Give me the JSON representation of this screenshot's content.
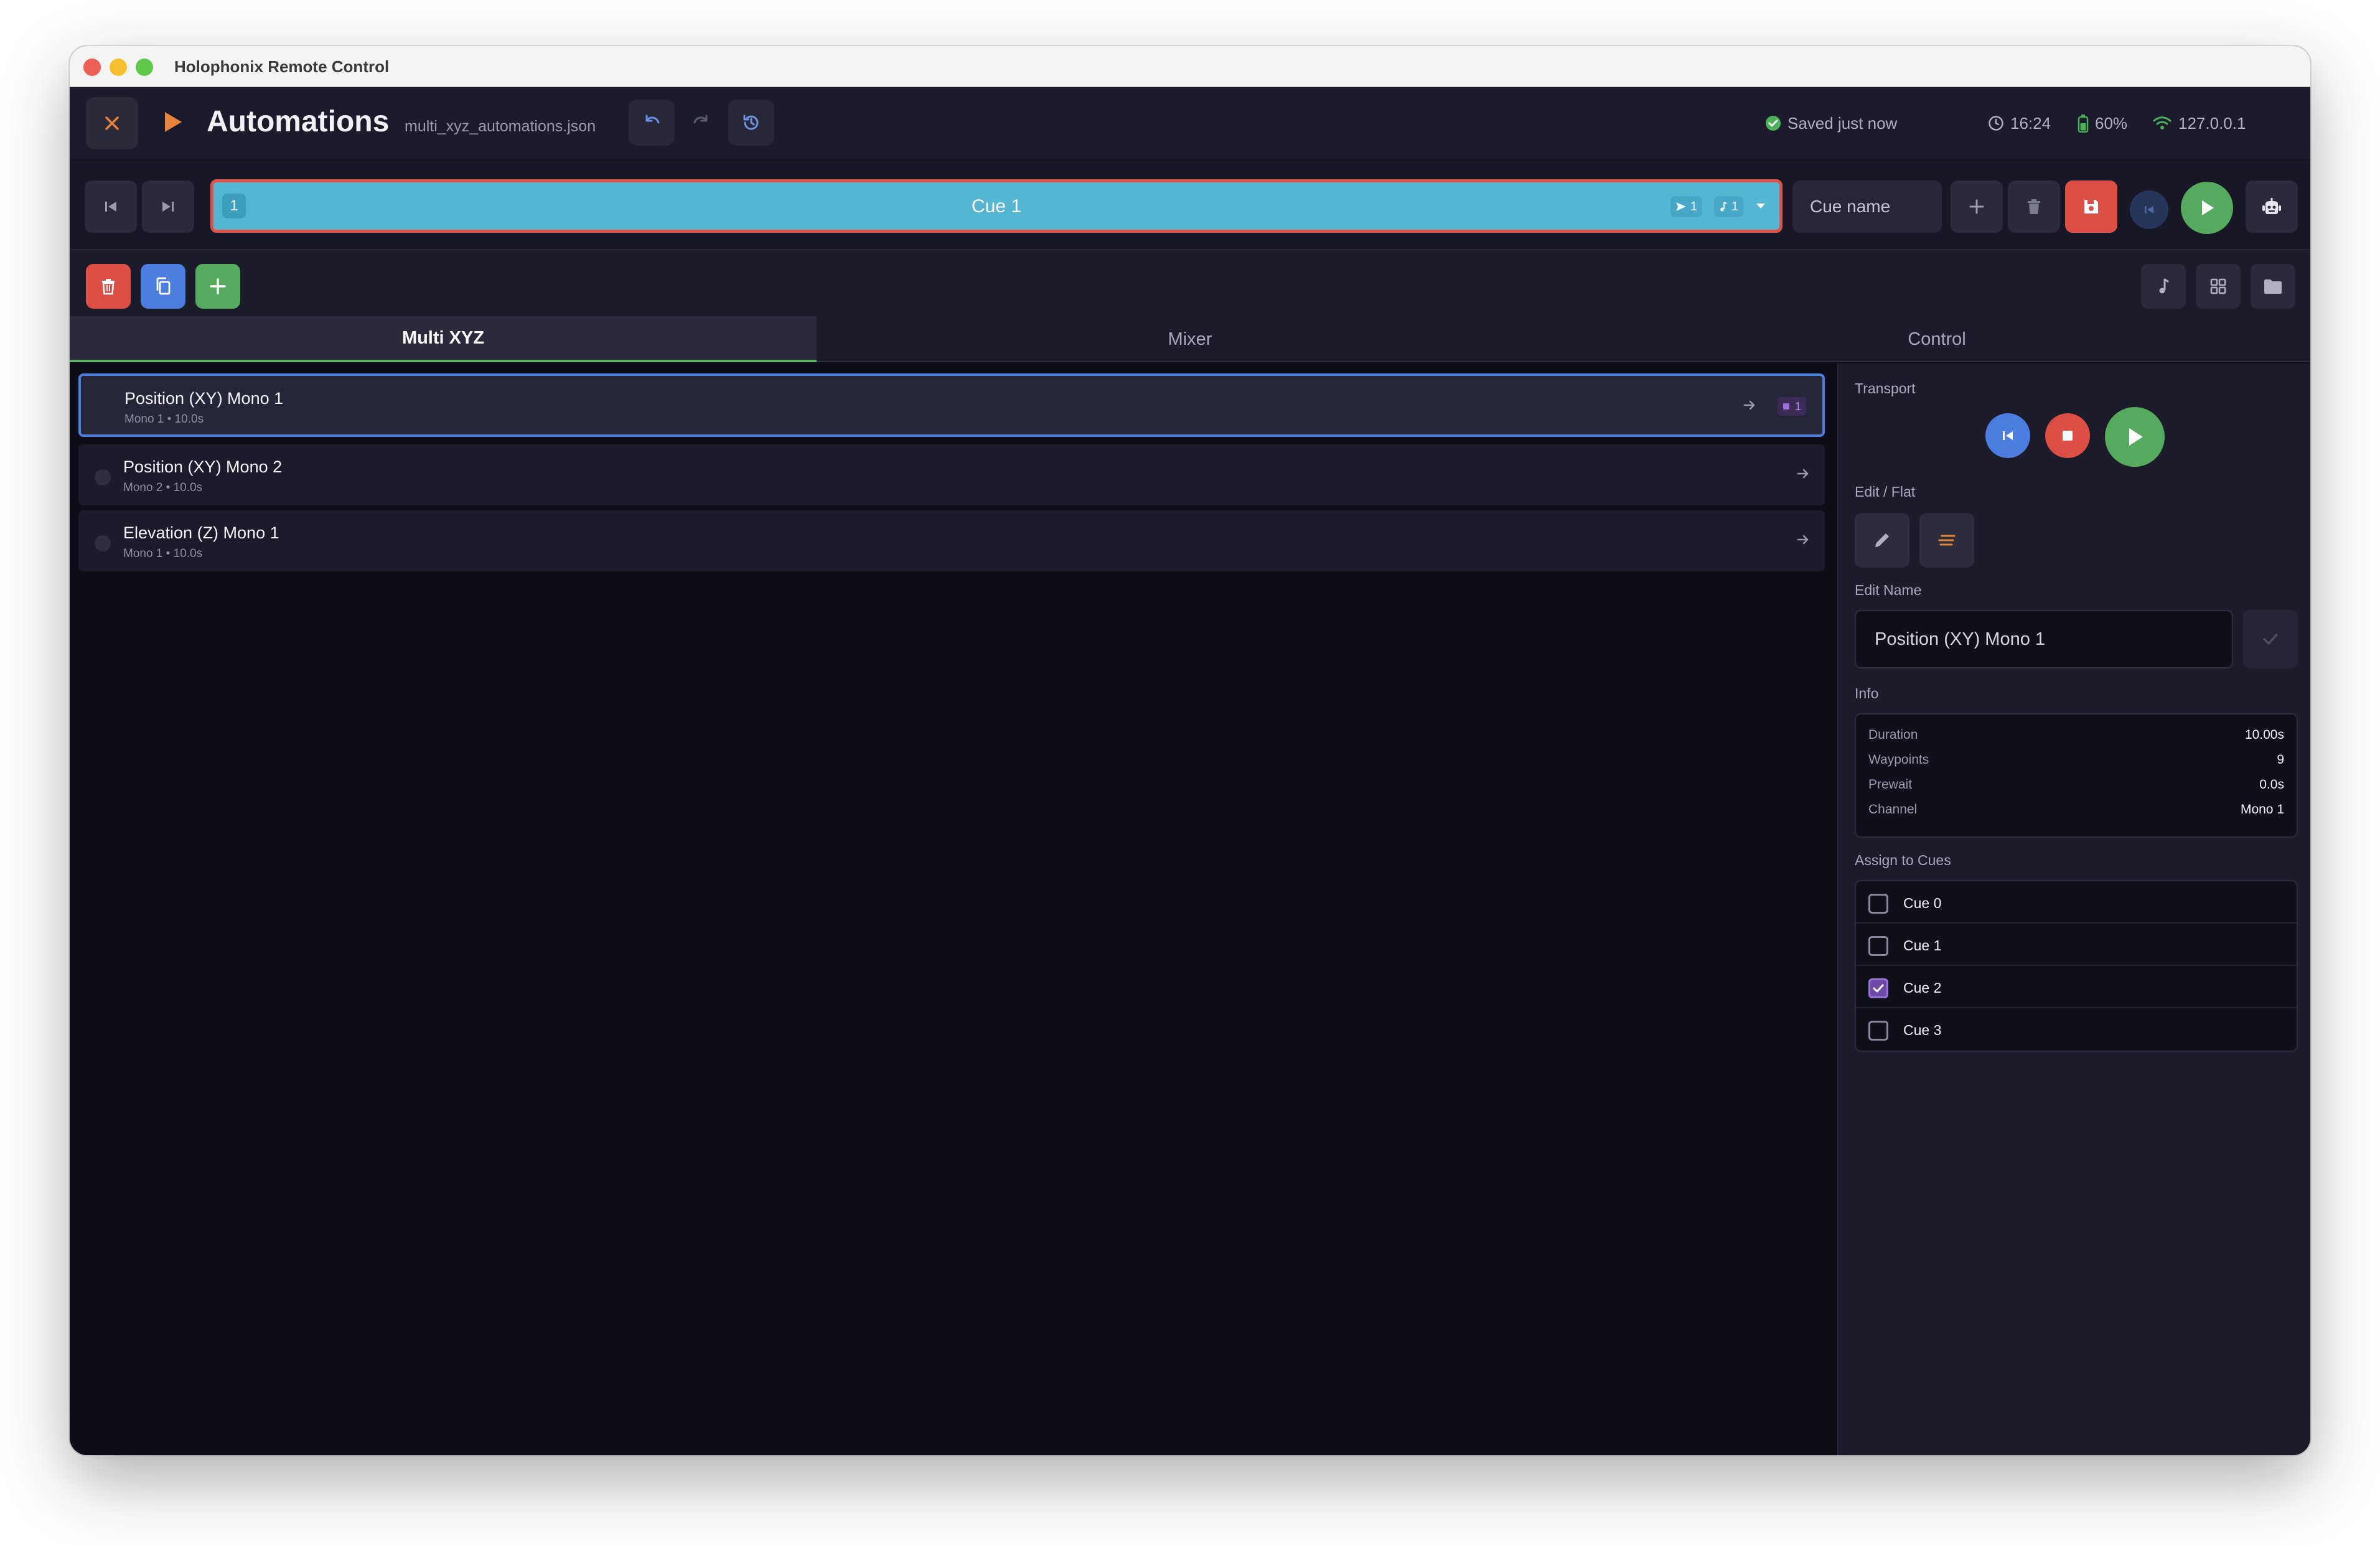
{
  "window": {
    "title": "Holophonix Remote Control"
  },
  "header": {
    "title": "Automations",
    "file_name": "multi_xyz_automations.json",
    "status": {
      "saved": "Saved just now",
      "time": "16:24",
      "battery": "60%",
      "network": "127.0.0.1"
    }
  },
  "cuebar": {
    "selected_cue": {
      "number": "1",
      "name": "Cue 1",
      "badge_tracks": "1",
      "badge_music": "1"
    },
    "cue_name_placeholder": "Cue name"
  },
  "tabs": [
    {
      "label": "Multi XYZ",
      "active": true
    },
    {
      "label": "Mixer",
      "active": false
    },
    {
      "label": "Control",
      "active": false
    }
  ],
  "list": {
    "items": [
      {
        "title": "Position (XY) Mono 1",
        "subtitle": "Mono 1 • 10.0s",
        "tag": "1",
        "selected": true
      },
      {
        "title": "Position (XY) Mono 2",
        "subtitle": "Mono 2 • 10.0s",
        "selected": false
      },
      {
        "title": "Elevation (Z) Mono 1",
        "subtitle": "Mono 1 • 10.0s",
        "selected": false
      }
    ]
  },
  "panel": {
    "transport_label": "Transport",
    "edit_flat_label": "Edit / Flat",
    "edit_name_label": "Edit Name",
    "edit_name_value": "Position (XY) Mono 1",
    "info_label": "Info",
    "info": [
      {
        "key": "Duration",
        "value": "10.00s"
      },
      {
        "key": "Waypoints",
        "value": "9"
      },
      {
        "key": "Prewait",
        "value": "0.0s"
      },
      {
        "key": "Channel",
        "value": "Mono 1"
      }
    ],
    "assign_label": "Assign to Cues",
    "assign": [
      {
        "label": "Cue 0",
        "checked": false
      },
      {
        "label": "Cue 1",
        "checked": false
      },
      {
        "label": "Cue 2",
        "checked": true
      },
      {
        "label": "Cue 3",
        "checked": false
      }
    ]
  },
  "colors": {
    "accent_orange": "#e8843a",
    "cue_blue": "#55b6d3",
    "danger_red": "#dd4f44",
    "success_green": "#55aa5e",
    "info_blue": "#4c7ee0",
    "purple": "#6d4aa8"
  }
}
